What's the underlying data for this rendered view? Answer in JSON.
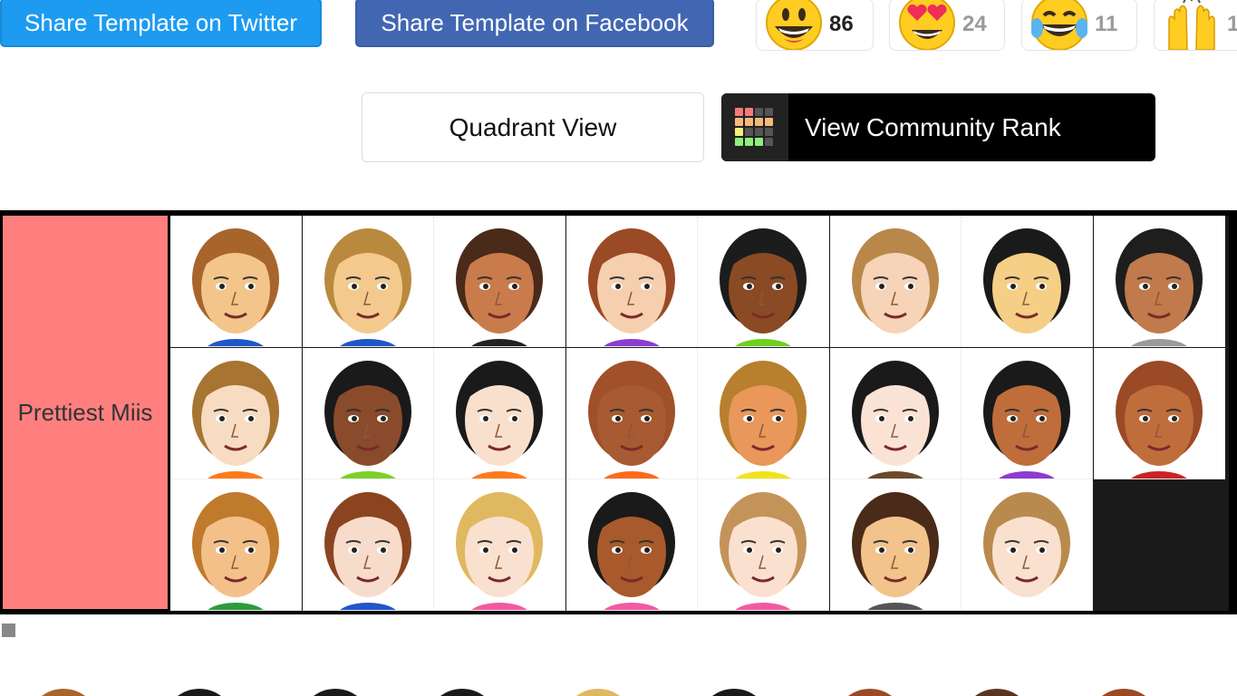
{
  "share": {
    "twitter_label": "Share Template on Twitter",
    "facebook_label": "Share Template on Facebook"
  },
  "reactions": [
    {
      "icon": "grinning-face-icon",
      "count": "86"
    },
    {
      "icon": "heart-eyes-face-icon",
      "count": "24"
    },
    {
      "icon": "tears-of-joy-face-icon",
      "count": "11"
    },
    {
      "icon": "raising-hands-icon",
      "count": "1"
    }
  ],
  "views": {
    "quadrant_label": "Quadrant View",
    "community_rank_label": "View Community Rank"
  },
  "tier": {
    "label": "Prettiest Miis",
    "color": "#ff7f7f",
    "items": [
      {
        "hair": "#a8652b",
        "skin": "#f3c58a",
        "shirt": "#1f57c9"
      },
      {
        "hair": "#b98a3e",
        "skin": "#f4c98e",
        "shirt": "#1f57c9"
      },
      {
        "hair": "#4a2a18",
        "skin": "#c97b4b",
        "shirt": "#222222"
      },
      {
        "hair": "#9a4a25",
        "skin": "#f6cfae",
        "shirt": "#8d3bd1"
      },
      {
        "hair": "#1c1c1c",
        "skin": "#8a4a24",
        "shirt": "#6ecf1f"
      },
      {
        "hair": "#b9874a",
        "skin": "#f7d3b8",
        "shirt": "#ffffff"
      },
      {
        "hair": "#1a1a1a",
        "skin": "#f5cf85",
        "shirt": "#ffffff"
      },
      {
        "hair": "#1e1e1e",
        "skin": "#c07a4b",
        "shirt": "#9a9a9a"
      },
      {
        "hair": "#a87432",
        "skin": "#f7dcc2",
        "shirt": "#ff7a1a"
      },
      {
        "hair": "#1a1a1a",
        "skin": "#8a4a2c",
        "shirt": "#7bd12a"
      },
      {
        "hair": "#1a1a1a",
        "skin": "#f9e0cc",
        "shirt": "#ff7a1a"
      },
      {
        "hair": "#a0512a",
        "skin": "#a85a32",
        "shirt": "#ff6a1a"
      },
      {
        "hair": "#b87f2e",
        "skin": "#e9975a",
        "shirt": "#f2e21c"
      },
      {
        "hair": "#1a1a1a",
        "skin": "#fae3d5",
        "shirt": "#6a4b2a"
      },
      {
        "hair": "#1a1a1a",
        "skin": "#c06d3c",
        "shirt": "#8d3bd1"
      },
      {
        "hair": "#9a4a25",
        "skin": "#c06d3c",
        "shirt": "#cc2222"
      },
      {
        "hair": "#c07a2c",
        "skin": "#f4c08a",
        "shirt": "#2a9d3a"
      },
      {
        "hair": "#8a4520",
        "skin": "#f8dccb",
        "shirt": "#1f57c9"
      },
      {
        "hair": "#e0b860",
        "skin": "#fae0cf",
        "shirt": "#f25aa0"
      },
      {
        "hair": "#1a1a1a",
        "skin": "#a85a2c",
        "shirt": "#f25aa0"
      },
      {
        "hair": "#c4935a",
        "skin": "#fae0cf",
        "shirt": "#f25aa0"
      },
      {
        "hair": "#4a2a18",
        "skin": "#f2c38a",
        "shirt": "#555555"
      },
      {
        "hair": "#b98a4e",
        "skin": "#fae0cf",
        "shirt": "#ffffff"
      }
    ]
  }
}
